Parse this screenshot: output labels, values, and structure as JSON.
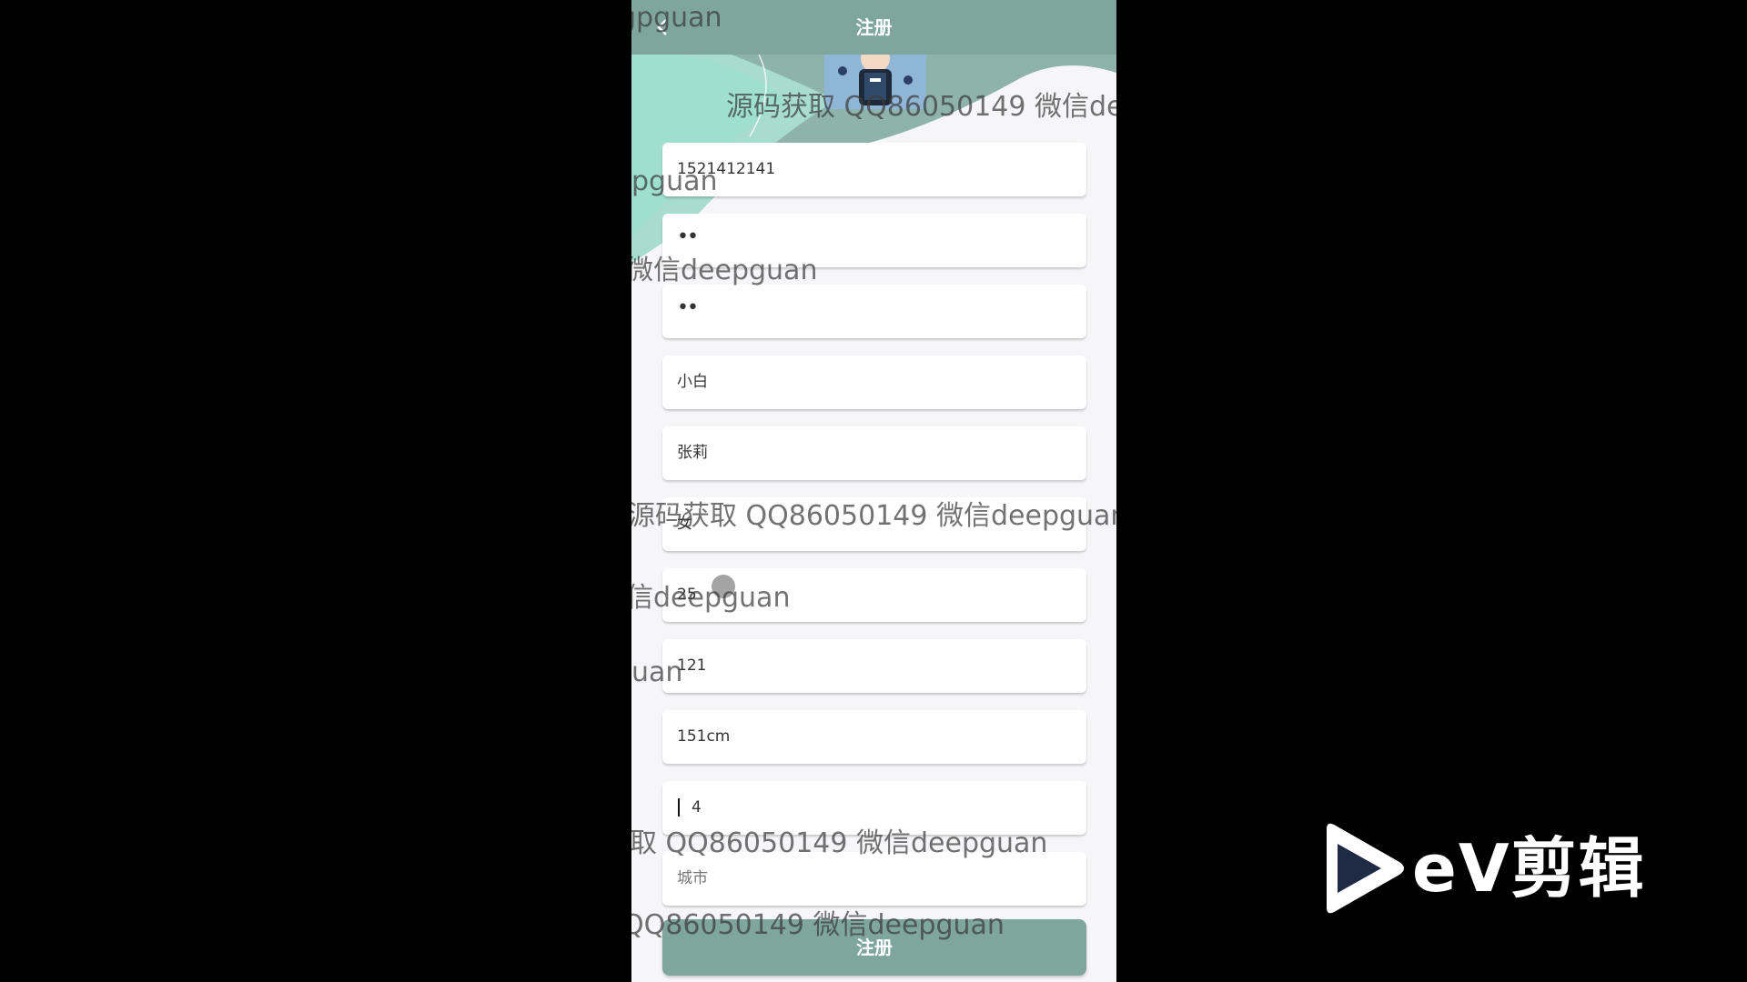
{
  "header": {
    "title": "注册",
    "back_icon": "chevron-left-icon"
  },
  "form": {
    "fields": [
      {
        "value": "1521412141",
        "type": "text"
      },
      {
        "value": "••",
        "type": "password"
      },
      {
        "value": "••",
        "type": "password"
      },
      {
        "value": "小白",
        "type": "text"
      },
      {
        "value": "张莉",
        "type": "text"
      },
      {
        "value": "女",
        "type": "text"
      },
      {
        "value": "25",
        "type": "text"
      },
      {
        "value": "121",
        "type": "text"
      },
      {
        "value": "151cm",
        "type": "text"
      },
      {
        "value": "4",
        "type": "text"
      },
      {
        "placeholder": "城市",
        "type": "text"
      }
    ],
    "submit_label": "注册"
  },
  "watermark": {
    "lines": [
      "gpguan",
      "源码获取 QQ86050149 微信dee",
      "pguan",
      "微信deepguan",
      "源码获取 QQ86050149 微信deepguan",
      "信deepguan",
      "uan",
      "取 QQ86050149 微信deepguan",
      "QQ86050149 微信deepguan"
    ]
  },
  "brand": {
    "logo_text": "eV剪辑"
  },
  "colors": {
    "accent": "#7ea69c",
    "background": "#000000",
    "panel": "#f6f6f8"
  }
}
